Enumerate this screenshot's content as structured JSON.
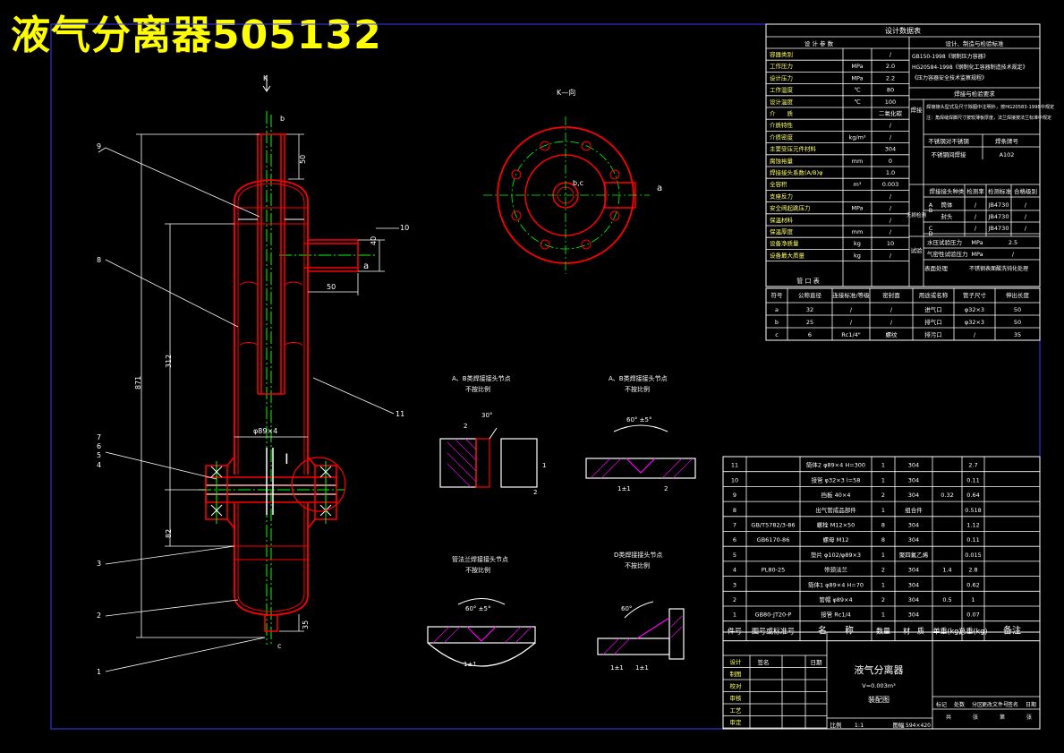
{
  "header": {
    "title": "液气分离器505132"
  },
  "colors": {
    "background": "#000000",
    "outline": "#ffffff",
    "vessel": "#ff0000",
    "centerline": "#00ff00",
    "dimension": "#ffff00",
    "hatch": "#ff00ff",
    "frame": "#0000ff"
  },
  "main_view": {
    "section_arrow": "K",
    "nozzle_labels": [
      "b",
      "a",
      "c"
    ],
    "dims": {
      "top": "50",
      "nozzle": "40",
      "stub": "50",
      "inner": "312",
      "overall": "871",
      "shell": "φ89×4",
      "lower": "82",
      "bottom": "35"
    },
    "detail_mark": "I",
    "leaders": [
      "9",
      "8",
      "7",
      "6",
      "5",
      "4",
      "3",
      "2",
      "1",
      "10",
      "11"
    ]
  },
  "k_view": {
    "title": "K—向",
    "center_label": "b,c",
    "nozzle_label": "a"
  },
  "weld_details": [
    {
      "title": "A、B类焊接接头节点",
      "sub": "不按比例",
      "angle": "30°",
      "dims": [
        "2",
        "1",
        "2"
      ]
    },
    {
      "title": "A、B类焊接接头节点",
      "sub": "不按比例",
      "angle": "60° ±5°",
      "dims": [
        "1±1",
        "2"
      ]
    },
    {
      "title": "管法兰焊接接头节点",
      "sub": "不按比例",
      "angle": "60° ±5°",
      "dims": [
        "1±1"
      ]
    },
    {
      "title": "D类焊接接头节点",
      "sub": "不按比例",
      "angle": "60°",
      "dims": [
        "1±1",
        "1±1"
      ]
    }
  ],
  "design_table": {
    "title": "设计数据表",
    "col_heads": [
      "设 计 参 数",
      "设计、制造与检验标准"
    ],
    "rows": [
      [
        "容器类别",
        "",
        "/"
      ],
      [
        "工作压力",
        "MPa",
        "2.0"
      ],
      [
        "设计压力",
        "MPa",
        "2.2"
      ],
      [
        "工作温度",
        "℃",
        "80"
      ],
      [
        "设计温度",
        "℃",
        "100"
      ],
      [
        "介　　质",
        "",
        "二氧化碳"
      ],
      [
        "介质特性",
        "",
        "/"
      ],
      [
        "介质密度",
        "kg/m³",
        "/"
      ],
      [
        "主要受压元件材料",
        "",
        "304"
      ],
      [
        "腐蚀裕量",
        "mm",
        "0"
      ],
      [
        "焊接接头系数(A/B)φ",
        "",
        "1.0"
      ],
      [
        "全容积",
        "m³",
        "0.003"
      ],
      [
        "支座反力",
        "",
        "/"
      ],
      [
        "安全阀起跳压力",
        "MPa",
        "/"
      ],
      [
        "保温材料",
        "",
        "/"
      ],
      [
        "保温厚度",
        "mm",
        "/"
      ],
      [
        "设备净质量",
        "kg",
        "10"
      ],
      [
        "设备最大质量",
        "kg",
        "/"
      ]
    ],
    "standards": [
      "GB150-1998《钢制压力容器》",
      "HG20584-1998《钢制化工容器制造技术规定》",
      "《压力容器安全技术监察规程》"
    ],
    "weld_section_title": "焊接与检验要求",
    "weld_req_label": "焊接",
    "weld_req": "焊接接头型式及尺寸除图中注明外，按HG20583-1998中规定",
    "weld_req2": "注：角焊缝焊脚尺寸按较薄板厚度，法兰焊接按法兰标准中规定",
    "weld_mat_head": [
      "不锈钢对不锈钢",
      "焊条牌号"
    ],
    "weld_mat_rows": [
      [
        "不锈钢间焊接",
        "A102"
      ]
    ],
    "ndt_label": "无损检测",
    "ndt_head": [
      "焊接接头种类",
      "检测率",
      "检测标准",
      "合格级别"
    ],
    "ndt_rows": [
      [
        "A",
        "B",
        "筒体",
        "/",
        "JB4730",
        "/"
      ],
      [
        "",
        "",
        "封头",
        "/",
        "JB4730",
        "/"
      ],
      [
        "C",
        "D",
        "",
        "/",
        "JB4730",
        "/"
      ]
    ],
    "test_label": "试验",
    "test_rows": [
      [
        "水压试验压力",
        "MPa",
        "2.5"
      ],
      [
        "气密性试验压力",
        "MPa",
        "/"
      ]
    ],
    "finish_label": "表面处理",
    "finish": "不锈钢表面酸洗钝化处理"
  },
  "nozzle_table": {
    "title": "管 口 表",
    "head": [
      "符号",
      "公称直径",
      "连接标准/等级",
      "密封面",
      "用途或名称",
      "管子尺寸",
      "伸出长度"
    ],
    "rows": [
      [
        "a",
        "32",
        "/",
        "/",
        "进气口",
        "φ32×3",
        "50"
      ],
      [
        "b",
        "25",
        "/",
        "/",
        "排气口",
        "φ32×3",
        "50"
      ],
      [
        "c",
        "6",
        "Rc1/4\"",
        "螺纹",
        "排污口",
        "/",
        "35"
      ]
    ]
  },
  "parts_table": {
    "head": [
      "件号",
      "图号或标准号",
      "名　　称",
      "数量",
      "材　质",
      "单重(kg)",
      "总重(kg)",
      "备注"
    ],
    "rows": [
      [
        "11",
        "",
        "筒体2 φ89×4 H=300",
        "1",
        "304",
        "",
        "2.7",
        ""
      ],
      [
        "10",
        "",
        "接管 φ32×3 l=58",
        "1",
        "304",
        "",
        "0.11",
        ""
      ],
      [
        "9",
        "",
        "挡板 40×4",
        "2",
        "304",
        "0.32",
        "0.64",
        ""
      ],
      [
        "8",
        "",
        "出气管成品部件",
        "1",
        "组合件",
        "",
        "0.518",
        ""
      ],
      [
        "7",
        "GB/T5782/3-86",
        "螺栓 M12×50",
        "8",
        "304",
        "",
        "1.12",
        ""
      ],
      [
        "6",
        "GB6170-86",
        "螺母 M12",
        "8",
        "304",
        "",
        "0.11",
        ""
      ],
      [
        "5",
        "",
        "垫片 φ102/φ89×3",
        "1",
        "聚四氟乙烯",
        "",
        "0.015",
        ""
      ],
      [
        "4",
        "PL80-25",
        "带颈法兰",
        "2",
        "304",
        "1.4",
        "2.8",
        ""
      ],
      [
        "3",
        "",
        "筒体1 φ89×4 H=70",
        "1",
        "304",
        "",
        "0.62",
        ""
      ],
      [
        "2",
        "",
        "管帽 φ89×4",
        "2",
        "304",
        "0.5",
        "1",
        ""
      ],
      [
        "1",
        "GB80-JT20-P",
        "接管 Rc1/4",
        "1",
        "304",
        "",
        "0.07",
        ""
      ]
    ]
  },
  "title_block": {
    "labels": [
      "标记",
      "处数",
      "分区",
      "更改文件号",
      "签名",
      "日期"
    ],
    "roles": [
      "设计",
      "制图",
      "校对",
      "审核",
      "工艺",
      "审定"
    ],
    "name": "液气分离器",
    "spec": "V=0.003m³",
    "drawing": "装配图",
    "scale_label": "比例",
    "scale": "1:1",
    "sheet_label": "图幅",
    "sheet": "594×420",
    "sign_cols": [
      "签名",
      "日期"
    ],
    "stage_cols": [
      "标记",
      "数量",
      "重量",
      "比例"
    ],
    "stage_cols2": [
      "共",
      "张",
      "第",
      "张"
    ]
  }
}
